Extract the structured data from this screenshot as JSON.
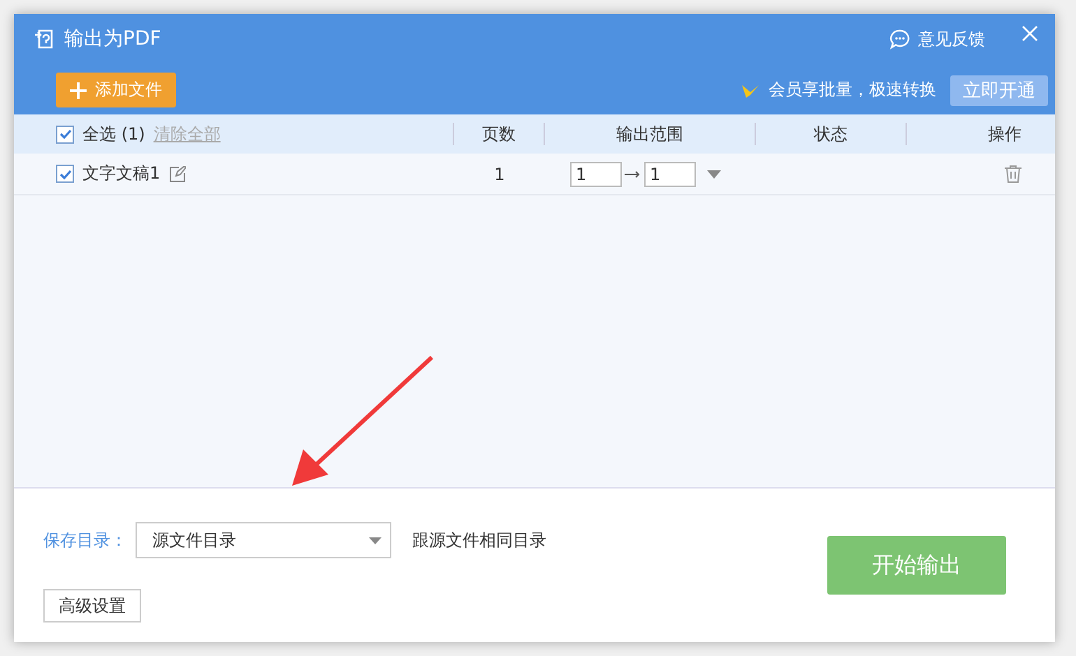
{
  "window": {
    "title": "输出为PDF",
    "feedback": "意见反馈"
  },
  "toolbar": {
    "add_button": "添加文件",
    "promo": "会员享批量，极速转换",
    "upgrade_button": "立即开通"
  },
  "table": {
    "select_all": {
      "label": "全选",
      "count": "(1)",
      "checked": true
    },
    "clear_link": "清除全部",
    "columns": [
      "页数",
      "输出范围",
      "状态",
      "操作"
    ],
    "rows": [
      {
        "name": "文字文稿1",
        "checked": true,
        "pages": "1",
        "from": "1",
        "to": "1"
      }
    ]
  },
  "footer": {
    "save_label": "保存目录：",
    "save_dir": "源文件目录",
    "save_hint": "跟源文件相同目录",
    "advanced_button": "高级设置",
    "start_button": "开始输出"
  }
}
